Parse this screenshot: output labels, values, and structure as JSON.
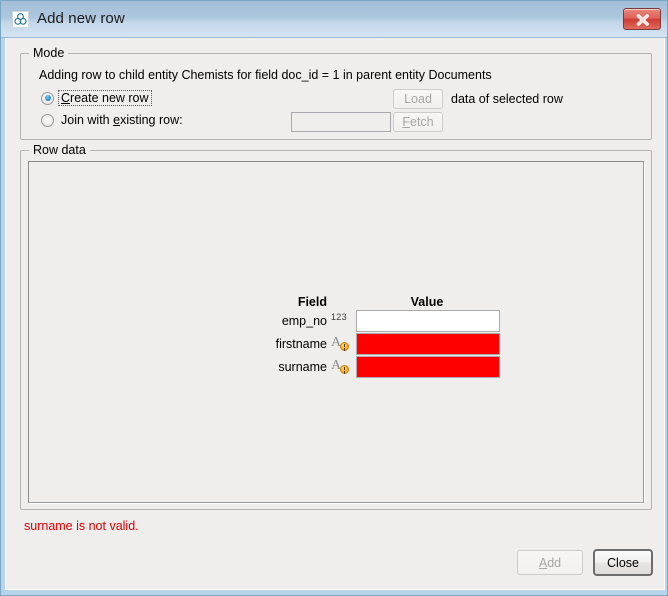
{
  "window": {
    "title": "Add new row",
    "icon": "app-overlapping-circles-icon",
    "close_label": "Close window"
  },
  "mode": {
    "legend": "Mode",
    "description": "Adding row to child entity Chemists for field doc_id = 1 in parent entity Documents",
    "options": [
      {
        "label": "Create new row",
        "mnemonic": "C",
        "selected": true,
        "focused": true
      },
      {
        "label": "Join with existing row:",
        "mnemonic": "e",
        "selected": false,
        "focused": false
      }
    ],
    "load_button": "Load",
    "load_caption": "data of selected row",
    "fetch_button": "Fetch",
    "fetch_mnemonic": "F",
    "join_input_value": "",
    "join_input_placeholder": ""
  },
  "row_data": {
    "legend": "Row data",
    "headers": {
      "field": "Field",
      "value": "Value"
    },
    "rows": [
      {
        "field": "emp_no",
        "type_icon": "number-type-icon",
        "type_glyph": "123",
        "value": "",
        "state": "ok"
      },
      {
        "field": "firstname",
        "type_icon": "text-type-icon",
        "type_glyph": "A",
        "value": "",
        "state": "error"
      },
      {
        "field": "surname",
        "type_icon": "text-type-icon",
        "type_glyph": "A",
        "value": "",
        "state": "error"
      }
    ]
  },
  "status": {
    "error_message": "surname is not valid."
  },
  "footer": {
    "add_label": "Add",
    "add_mnemonic": "A",
    "add_enabled": false,
    "close_label": "Close",
    "close_default": true
  },
  "colors": {
    "error_red": "#fe0000",
    "error_text": "#e00000",
    "titlebar_blue": "#adc6de",
    "frame_blue": "#b8d4e8",
    "dialog_bg": "#efeeed",
    "accent_teal": "#1f7a8c"
  }
}
